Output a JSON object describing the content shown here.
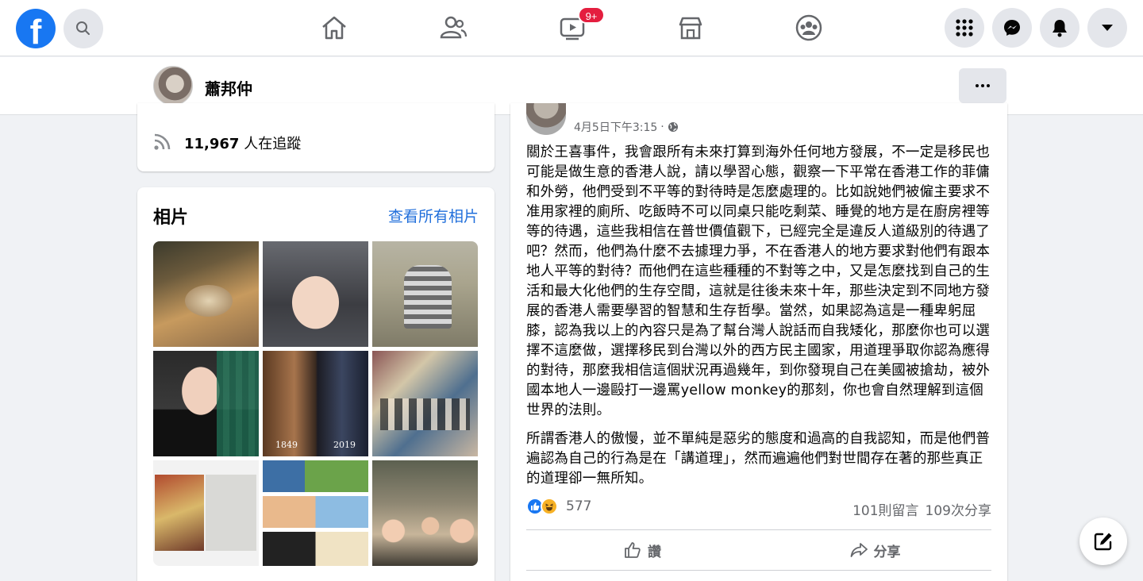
{
  "topnav": {
    "logo": "f",
    "icons": [
      "facebook-logo",
      "search-icon",
      "home-icon",
      "friends-icon",
      "watch-icon",
      "marketplace-icon",
      "groups-icon",
      "menu-grid-icon",
      "messenger-icon",
      "notifications-icon",
      "account-dropdown-icon"
    ],
    "watch_badge": "9+",
    "badge_color": "#e41e3f",
    "brand_color": "#1877f2"
  },
  "profile_bar": {
    "name": "蕭邦仲",
    "more_button": "more-options"
  },
  "followers": {
    "count": "11,967",
    "suffix": " 人在追蹤"
  },
  "photos": {
    "title": "相片",
    "see_all": "查看所有相片",
    "labels": {
      "left": "1849",
      "right": "2019"
    }
  },
  "post": {
    "timestamp": "4月5日下午3:15",
    "separator": " · ",
    "privacy_icon": "globe-icon",
    "paragraphs": [
      "關於王喜事件，我會跟所有未來打算到海外任何地方發展，不一定是移民也可能是做生意的香港人說，請以學習心態，觀察一下平常在香港工作的菲傭和外勞，他們受到不平等的對待時是怎麼處理的。比如說她們被僱主要求不准用家裡的廁所、吃飯時不可以同桌只能吃剩菜、睡覺的地方是在廚房裡等等的待遇，這些我相信在普世價值觀下，已經完全是違反人道級別的待遇了吧？然而，他們為什麼不去據理力爭，不在香港人的地方要求對他們有跟本地人平等的對待？而他們在這些種種的不對等之中，又是怎麼找到自己的生活和最大化他們的生存空間，這就是往後未來十年，那些決定到不同地方發展的香港人需要學習的智慧和生存哲學。當然，如果認為這是一種卑躬屈膝，認為我以上的內容只是為了幫台灣人說話而自我矮化，那麼你也可以選擇不這麼做，選擇移民到台灣以外的西方民主國家，用道理爭取你認為應得的對待，那麼我相信這個狀況再過幾年，到你發現自己在美國被搶劫，被外國本地人一邊毆打一邊罵yellow monkey的那刻，你也會自然理解到這個世界的法則。",
      "所謂香港人的傲慢，並不單純是惡劣的態度和過高的自我認知，而是他們普遍認為自己的行為是在「講道理」，然而遍遍他們對世間存在著的那些真正的道理卻一無所知。"
    ],
    "reaction_count": "577",
    "comments": "101則留言",
    "shares": "109次分享",
    "like_label": "讚",
    "share_label": "分享"
  }
}
